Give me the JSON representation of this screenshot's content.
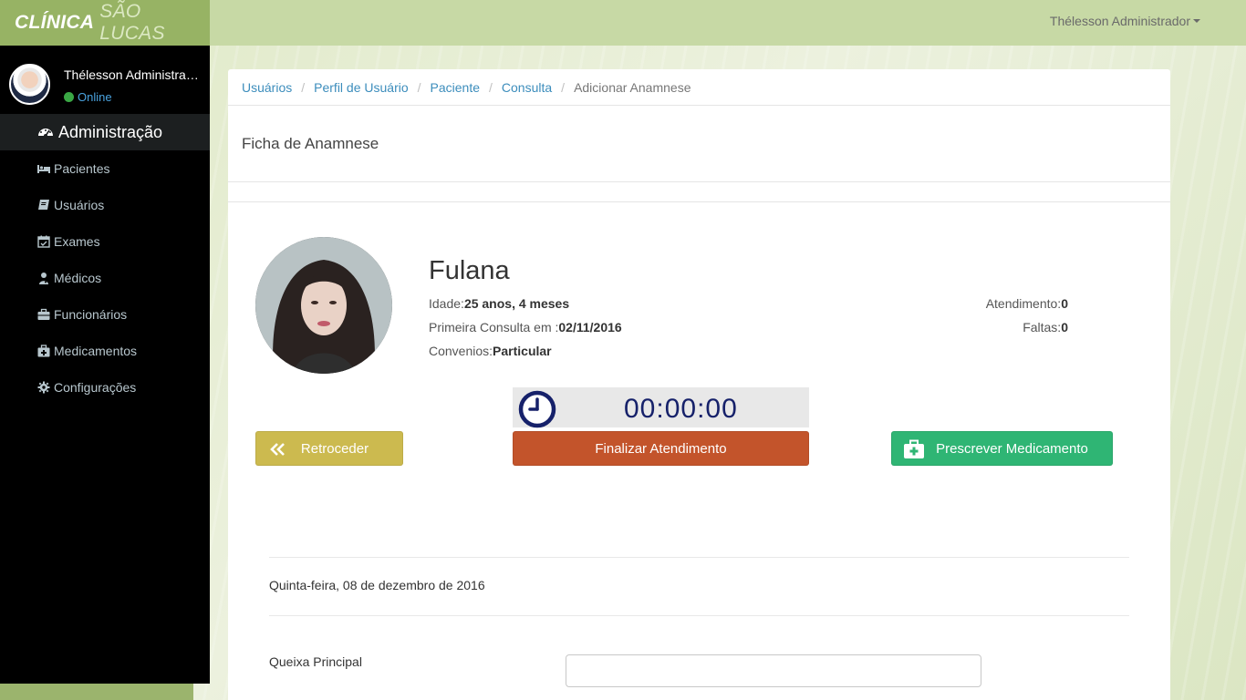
{
  "brand": {
    "part1": "CLÍNICA",
    "part2": "SÃO LUCAS"
  },
  "topbar": {
    "user_menu": "Thélesson Administrador"
  },
  "sidebar": {
    "user_name": "Thélesson Administrador",
    "status": "Online",
    "header": {
      "label": "Administração",
      "icon": "dashboard-icon"
    },
    "items": [
      {
        "label": "Pacientes",
        "icon": "bed-icon"
      },
      {
        "label": "Usuários",
        "icon": "book-icon"
      },
      {
        "label": "Exames",
        "icon": "calendar-check-icon"
      },
      {
        "label": "Médicos",
        "icon": "user-md-icon"
      },
      {
        "label": "Funcionários",
        "icon": "briefcase-icon"
      },
      {
        "label": "Medicamentos",
        "icon": "medkit-icon"
      },
      {
        "label": "Configurações",
        "icon": "gear-icon"
      }
    ]
  },
  "breadcrumb": {
    "items": [
      "Usuários",
      "Perfil de Usuário",
      "Paciente",
      "Consulta"
    ],
    "active": "Adicionar Anamnese"
  },
  "panel": {
    "title": "Ficha de Anamnese"
  },
  "patient": {
    "name": "Fulana",
    "age_label": "Idade:",
    "age_value": "25 anos, 4 meses",
    "first_consult_label": "Primeira Consulta em :",
    "first_consult_value": "02/11/2016",
    "insurance_label": "Convenios:",
    "insurance_value": "Particular",
    "attendance_label": "Atendimento:",
    "attendance_value": "0",
    "absences_label": "Faltas:",
    "absences_value": "0"
  },
  "timer": {
    "value": "00:00:00",
    "icon": "clock-icon"
  },
  "buttons": {
    "back": "Retroceder",
    "finish": "Finalizar Atendimento",
    "prescribe": "Prescrever Medicamento"
  },
  "form": {
    "date": "Quinta-feira, 08 de dezembro de 2016",
    "main_complaint_label": "Queixa Principal",
    "main_complaint_value": ""
  },
  "colors": {
    "brand_bg": "#97b364",
    "topbar_bg": "#c7d9a5",
    "sidebar_bg": "#000000",
    "link": "#3c8dbc",
    "back_button": "#ccba4f",
    "finish_button": "#c3542b",
    "prescribe_button": "#2fb574",
    "timer_text": "#16216a"
  }
}
